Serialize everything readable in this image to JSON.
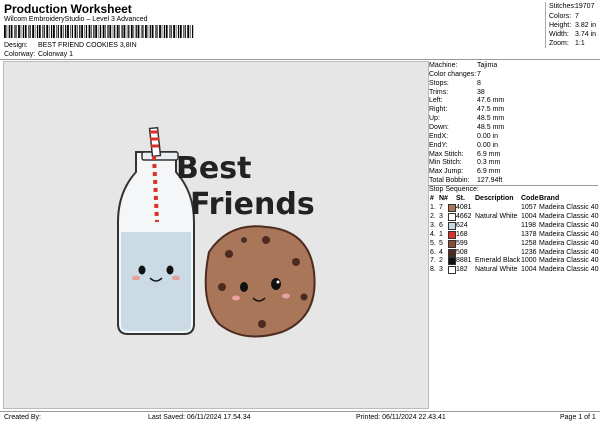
{
  "header": {
    "title": "Production Worksheet",
    "subtitle": "Wilcom EmbroideryStudio – Level 3 Advanced",
    "design_label": "Design:",
    "design_value": "BEST FRIEND COOKIES 3,8IN",
    "colorway_label": "Colorway:",
    "colorway_value": "Colorway 1"
  },
  "stats": [
    {
      "label": "Stitches:",
      "value": "19707"
    },
    {
      "label": "Colors:",
      "value": "7"
    },
    {
      "label": "Height:",
      "value": "3.82 in"
    },
    {
      "label": "Width:",
      "value": "3.74 in"
    },
    {
      "label": "Zoom:",
      "value": "1:1"
    }
  ],
  "design_text": {
    "line1": "Best",
    "line2": "Friends"
  },
  "info": [
    {
      "label": "Machine:",
      "value": "Tajima"
    },
    {
      "label": "Color changes:",
      "value": "7"
    },
    {
      "label": "Stops:",
      "value": "8"
    },
    {
      "label": "Trims:",
      "value": "38"
    },
    {
      "label": "Left:",
      "value": "47.6 mm"
    },
    {
      "label": "Right:",
      "value": "47.5 mm"
    },
    {
      "label": "Up:",
      "value": "48.5 mm"
    },
    {
      "label": "Down:",
      "value": "48.5 mm"
    },
    {
      "label": "EndX:",
      "value": "0.00 in"
    },
    {
      "label": "EndY:",
      "value": "0.00 in"
    },
    {
      "label": "Max Stitch:",
      "value": "6.9 mm"
    },
    {
      "label": "Min Stitch:",
      "value": "0.3 mm"
    },
    {
      "label": "Max Jump:",
      "value": "6.9 mm"
    },
    {
      "label": "Total Bobbin:",
      "value": "127.94ft"
    }
  ],
  "stop_sequence": {
    "title": "Stop Sequence:",
    "columns": [
      "#",
      "N#",
      "St.",
      "Description",
      "Code",
      "Brand"
    ],
    "rows": [
      {
        "num": "1.",
        "n": "7",
        "st": "4081",
        "desc": "",
        "code": "1057",
        "brand": "Madeira Classic 40",
        "color": "#a9765a"
      },
      {
        "num": "2.",
        "n": "3",
        "st": "4662",
        "desc": "Natural White",
        "code": "1004",
        "brand": "Madeira Classic 40",
        "color": "#ffffff"
      },
      {
        "num": "3.",
        "n": "6",
        "st": "624",
        "desc": "",
        "code": "1198",
        "brand": "Madeira Classic 40",
        "color": "#c7d8e3"
      },
      {
        "num": "4.",
        "n": "1",
        "st": "168",
        "desc": "",
        "code": "1378",
        "brand": "Madeira Classic 40",
        "color": "#d9302b"
      },
      {
        "num": "5.",
        "n": "5",
        "st": "599",
        "desc": "",
        "code": "1258",
        "brand": "Madeira Classic 40",
        "color": "#8a4e36"
      },
      {
        "num": "6.",
        "n": "4",
        "st": "508",
        "desc": "",
        "code": "1236",
        "brand": "Madeira Classic 40",
        "color": "#4e2b20"
      },
      {
        "num": "7.",
        "n": "2",
        "st": "8881",
        "desc": "Emerald Black",
        "code": "1000",
        "brand": "Madeira Classic 40",
        "color": "#111111"
      },
      {
        "num": "8.",
        "n": "3",
        "st": "182",
        "desc": "Natural White",
        "code": "1004",
        "brand": "Madeira Classic 40",
        "color": "#ffffff"
      }
    ]
  },
  "footer": {
    "created": "Created By:",
    "saved": "Last Saved: 06/11/2024 17.54.34",
    "printed": "Printed: 06/11/2024 22.43.41",
    "page": "Page 1 of 1"
  }
}
